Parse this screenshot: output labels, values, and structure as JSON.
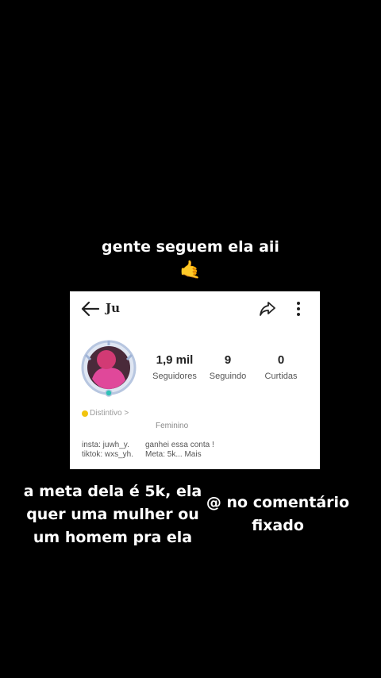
{
  "captions": {
    "top": "gente seguem ela aii",
    "top_emoji": "🤙",
    "left": "a meta dela é 5k, ela quer uma mulher ou um homem pra ela",
    "right": "@ no comentário fixado"
  },
  "profile": {
    "username": "Ju",
    "stats": [
      {
        "value": "1,9 mil",
        "label": "Seguidores"
      },
      {
        "value": "9",
        "label": "Seguindo"
      },
      {
        "value": "0",
        "label": "Curtidas"
      }
    ],
    "badge": "Distintivo >",
    "gender": "Feminino",
    "bio_left_1": "insta: juwh_y.",
    "bio_left_2": "tiktok: wxs_yh.",
    "bio_right_1": "ganhei essa conta !",
    "bio_right_2": "Meta: 5k...  Mais"
  },
  "icons": [
    "back-arrow-icon",
    "share-icon",
    "more-icon"
  ],
  "colors": {
    "background": "#000000",
    "card": "#ffffff",
    "avatar_accent": "#e0489a"
  }
}
